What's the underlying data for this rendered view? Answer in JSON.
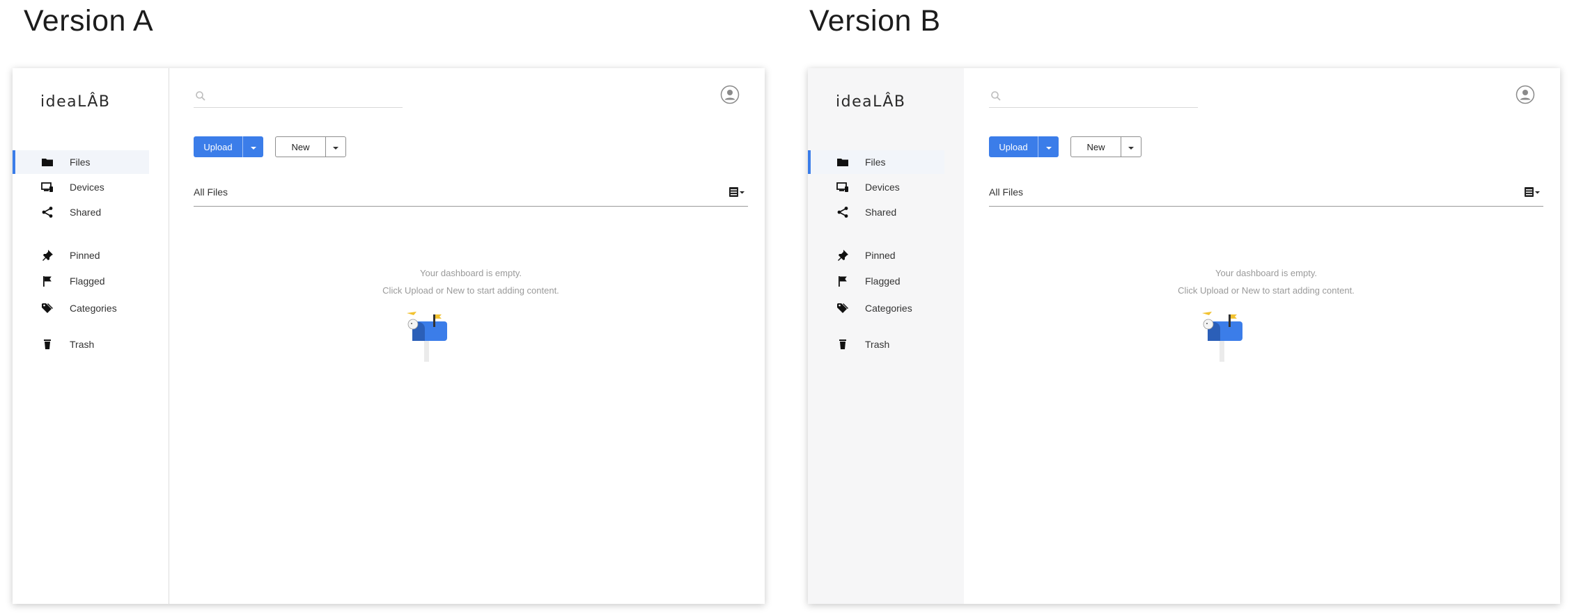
{
  "versions": [
    {
      "title": "Version A",
      "app": {
        "logo": "ideaLÂB",
        "nav_items": [
          {
            "label": "Files",
            "icon": "folder-icon",
            "active": true
          },
          {
            "label": "Devices",
            "icon": "devices-icon"
          },
          {
            "label": "Shared",
            "icon": "share-icon"
          },
          {
            "label": "Pinned",
            "icon": "pin-icon"
          },
          {
            "label": "Flagged",
            "icon": "flag-icon"
          },
          {
            "label": "Categories",
            "icon": "tag-icon"
          },
          {
            "label": "Trash",
            "icon": "trash-icon"
          }
        ],
        "search": {
          "placeholder": "",
          "value": ""
        },
        "toolbar": {
          "upload_label": "Upload",
          "new_label": "New"
        },
        "files_title": "All Files",
        "empty_state": {
          "line1": "Your dashboard is empty.",
          "line2": "Click Upload or New to start adding content."
        },
        "sidebar_style": "white with divider"
      }
    },
    {
      "title": "Version B",
      "app": {
        "logo": "ideaLÂB",
        "nav_items": [
          {
            "label": "Files",
            "icon": "folder-icon",
            "active": true
          },
          {
            "label": "Devices",
            "icon": "devices-icon"
          },
          {
            "label": "Shared",
            "icon": "share-icon"
          },
          {
            "label": "Pinned",
            "icon": "pin-icon"
          },
          {
            "label": "Flagged",
            "icon": "flag-icon"
          },
          {
            "label": "Categories",
            "icon": "tag-icon"
          },
          {
            "label": "Trash",
            "icon": "trash-icon"
          }
        ],
        "search": {
          "placeholder": "",
          "value": ""
        },
        "toolbar": {
          "upload_label": "Upload",
          "new_label": "New"
        },
        "files_title": "All Files",
        "empty_state": {
          "line1": "Your dashboard is empty.",
          "line2": "Click Upload or New to start adding content."
        },
        "sidebar_style": "light gray"
      }
    }
  ],
  "colors": {
    "accent": "#3b7de9",
    "sidebar_b_bg": "#f6f6f7",
    "active_item_bg": "#f2f5fa",
    "muted_text": "#9a9a9a"
  }
}
